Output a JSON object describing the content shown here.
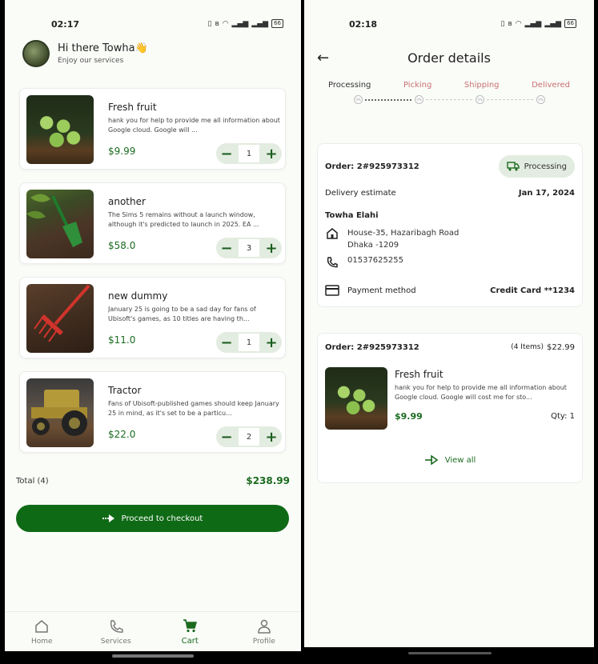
{
  "left": {
    "status_time": "02:17",
    "battery": "66",
    "greeting": "Hi there Towha👋",
    "greeting_sub": "Enjoy our services",
    "items": [
      {
        "name": "Fresh fruit",
        "desc": "hank you for help to provide me all information about Google cloud.  Google will ...",
        "price": "$9.99",
        "qty": "1"
      },
      {
        "name": "another",
        "desc": "The Sims 5 remains without a launch window, although it's predicted to launch in 2025. EA ...",
        "price": "$58.0",
        "qty": "3"
      },
      {
        "name": "new dummy",
        "desc": "January 25 is going to be a sad day for fans of Ubisoft's games, as 10 titles are having th...",
        "price": "$11.0",
        "qty": "1"
      },
      {
        "name": "Tractor",
        "desc": "Fans of Ubisoft-published games should keep January 25 in mind, as it's set to be a particu...",
        "price": "$22.0",
        "qty": "2"
      }
    ],
    "minus": "−",
    "plus": "+",
    "total_label": "Total (4)",
    "total_value": "$238.99",
    "checkout_label": "Proceed to checkout",
    "nav": [
      {
        "label": "Home",
        "icon": "home-icon"
      },
      {
        "label": "Services",
        "icon": "phone-icon"
      },
      {
        "label": "Cart",
        "icon": "cart-icon"
      },
      {
        "label": "Profile",
        "icon": "person-icon"
      }
    ],
    "active_color": "#1b6b1f"
  },
  "right": {
    "status_time": "02:18",
    "battery": "66",
    "title": "Order details",
    "steps": [
      "Processing",
      "Picking",
      "Shipping",
      "Delivered"
    ],
    "step_dot_text": "0%",
    "order_no": "Order: 2#925973312",
    "status": "Processing",
    "delivery_label": "Delivery estimate",
    "delivery_date": "Jan 17, 2024",
    "customer": "Towha Elahi",
    "address": "House-35, Hazaribagh Road\nDhaka -1209",
    "phone": "01537625255",
    "payment_label": "Payment method",
    "payment_value": "Credit Card **1234",
    "items_order_no": "Order: 2#925973312",
    "items_count": "(4 Items)",
    "items_total": "$22.99",
    "item": {
      "name": "Fresh fruit",
      "desc": "hank you for help to provide me all information about Google cloud.  Google will cost me for sto...",
      "price": "$9.99",
      "qty": "Qty: 1"
    },
    "view_all": "View all"
  },
  "colors": {
    "primary": "#0f6a15",
    "price": "#1b6b1f",
    "pending_step": "#c87070",
    "chip_bg": "#e3ece0"
  }
}
